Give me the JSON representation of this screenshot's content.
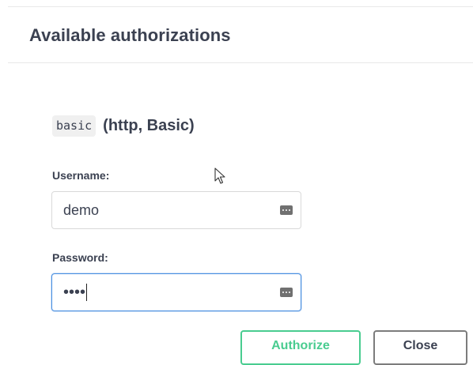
{
  "modal": {
    "title": "Available authorizations"
  },
  "scheme": {
    "name": "basic",
    "type": "(http, Basic)"
  },
  "username": {
    "label": "Username:",
    "value": "demo"
  },
  "password": {
    "label": "Password:",
    "value": "••••"
  },
  "buttons": {
    "authorize": "Authorize",
    "close": "Close"
  },
  "icons": {
    "username_field": "password-manager-icon",
    "password_field": "password-manager-icon",
    "cursor": "mouse-pointer-icon"
  },
  "colors": {
    "text": "#3b4151",
    "authorize_accent": "#49cc90",
    "focus_border": "#4a90e2",
    "close_border": "#7c7c7c"
  }
}
